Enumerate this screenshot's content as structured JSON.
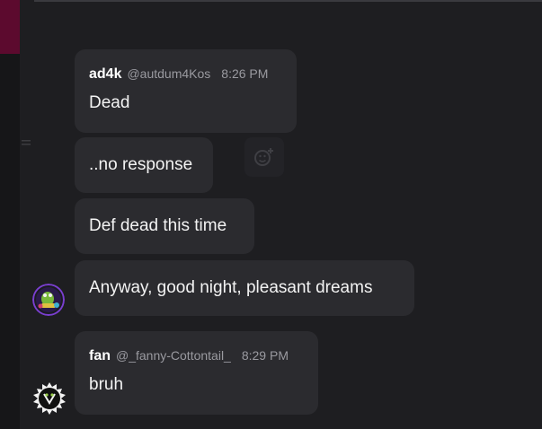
{
  "messages": [
    {
      "id": "m1",
      "author": "ad4k",
      "handle": "@autdum4Kos",
      "time": "8:26 PM",
      "text": "Dead"
    },
    {
      "id": "m2",
      "text": "..no response"
    },
    {
      "id": "m3",
      "text": "Def dead this time"
    },
    {
      "id": "m4",
      "text": "Anyway, good night, pleasant dreams"
    },
    {
      "id": "m5",
      "author": "fan",
      "handle": "@_fanny-Cottontail_",
      "time": "8:29 PM",
      "text": "bruh"
    }
  ],
  "icons": {
    "reaction": "add-reaction-icon",
    "avatar_ad4k": "avatar-ad4k",
    "avatar_fan": "avatar-fan"
  },
  "colors": {
    "background": "#1e1e21",
    "bubble": "#2b2b2f",
    "accent": "#5c0a2e"
  }
}
